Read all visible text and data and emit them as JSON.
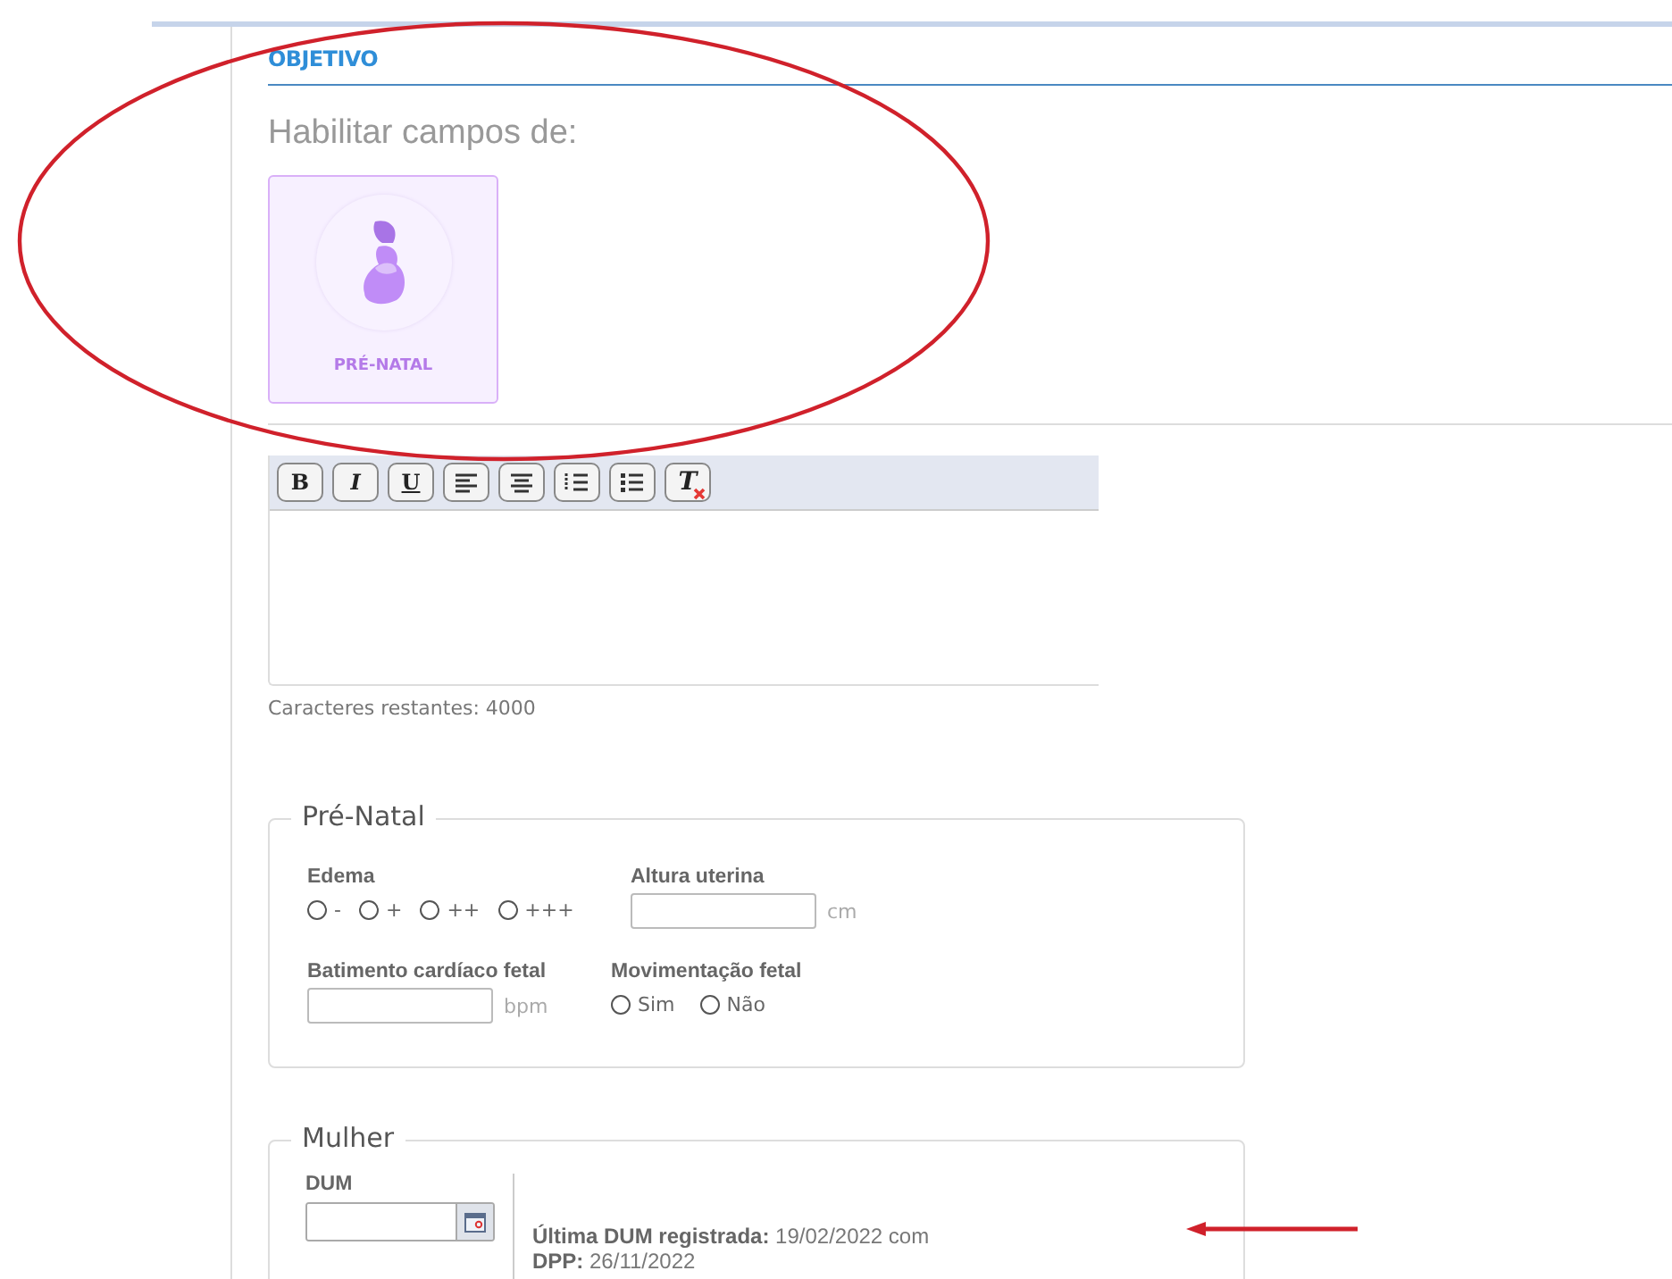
{
  "section": {
    "title": "OBJETIVO"
  },
  "enable": {
    "title": "Habilitar campos de:",
    "cards": [
      {
        "label": "PRÉ-NATAL",
        "kind": "pregnancy",
        "selected": true
      }
    ]
  },
  "editor": {
    "toolbar": [
      {
        "kind": "bold",
        "label": "B"
      },
      {
        "kind": "italic",
        "label": "I"
      },
      {
        "kind": "underline",
        "label": "U"
      },
      {
        "kind": "align-left"
      },
      {
        "kind": "align-center"
      },
      {
        "kind": "ordered-list"
      },
      {
        "kind": "bullet-list"
      },
      {
        "kind": "clear-format",
        "label": "T"
      }
    ],
    "counter": "Caracteres restantes: 4000"
  },
  "prenatal": {
    "legend": "Pré-Natal",
    "edema": {
      "label": "Edema",
      "options": [
        {
          "label": "-",
          "selected": false
        },
        {
          "label": "+",
          "selected": false
        },
        {
          "label": "++",
          "selected": false
        },
        {
          "label": "+++",
          "selected": false
        }
      ]
    },
    "altura": {
      "label": "Altura uterina",
      "unit": "cm"
    },
    "batimento": {
      "label": "Batimento cardíaco fetal",
      "unit": "bpm"
    },
    "movimentacao": {
      "label": "Movimentação fetal",
      "options": [
        {
          "label": "Sim",
          "selected": false
        },
        {
          "label": "Não",
          "selected": false
        }
      ]
    }
  },
  "mulher": {
    "legend": "Mulher",
    "dum": {
      "label": "DUM"
    },
    "info": [
      "**Última DUM registrada:** 19/02/2022 com",
      "**DPP:** 26/11/2022"
    ]
  },
  "annotation_ellipse": {
    "color": "#d0212b"
  },
  "annotation_arrow": {
    "color": "#d0212b"
  }
}
